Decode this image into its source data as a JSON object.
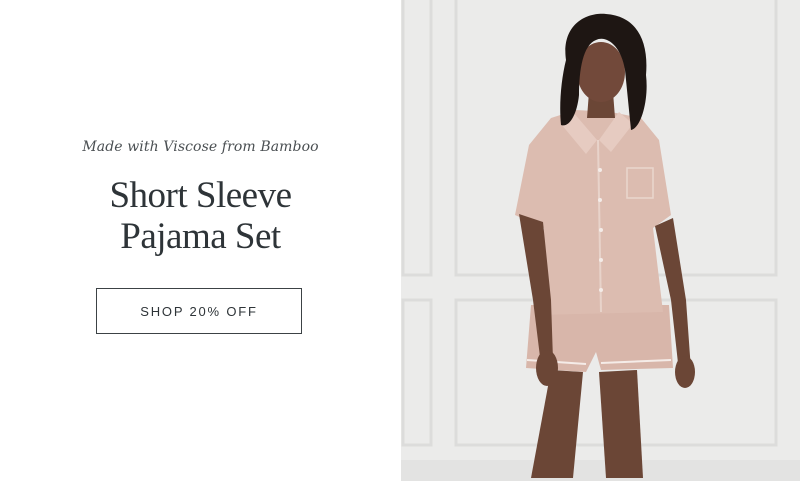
{
  "promo": {
    "eyebrow": "Made with Viscose from Bamboo",
    "headline_line1": "Short Sleeve",
    "headline_line2": "Pajama Set",
    "cta_label": "SHOP 20% OFF"
  },
  "colors": {
    "text_dark": "#2e3438",
    "wall": "#e9e9e9",
    "pajama": "#d9b8ac"
  }
}
